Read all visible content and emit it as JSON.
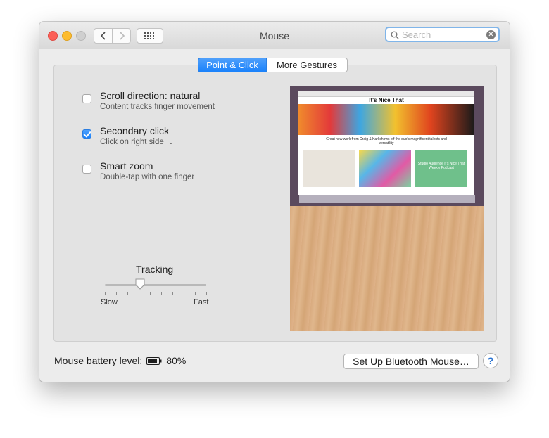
{
  "window": {
    "title": "Mouse"
  },
  "search": {
    "placeholder": "Search"
  },
  "tabs": [
    {
      "label": "Point & Click",
      "active": true
    },
    {
      "label": "More Gestures",
      "active": false
    }
  ],
  "options": [
    {
      "title": "Scroll direction: natural",
      "subtitle": "Content tracks finger movement",
      "checked": false
    },
    {
      "title": "Secondary click",
      "subtitle": "Click on right side",
      "checked": true,
      "has_dropdown": true
    },
    {
      "title": "Smart zoom",
      "subtitle": "Double-tap with one finger",
      "checked": false
    }
  ],
  "tracking": {
    "label": "Tracking",
    "min_label": "Slow",
    "max_label": "Fast",
    "value_fraction": 0.35,
    "tick_count": 10
  },
  "preview": {
    "site_title": "It's Nice That",
    "headline": "Great new work from Craig & Karl shows off the duo's magnificent talents and versatility",
    "card_text": "Studio Audience It's Nice That Weekly Podcast"
  },
  "footer": {
    "battery_label": "Mouse battery level:",
    "battery_value": "80%",
    "bluetooth_button": "Set Up Bluetooth Mouse…",
    "help": "?"
  },
  "colors": {
    "accent": "#1a82fb",
    "search_focus": "#80b5e9"
  },
  "icons": [
    "chevron-left-icon",
    "chevron-right-icon",
    "grid-icon",
    "search-icon",
    "clear-icon",
    "battery-icon",
    "chevron-down-icon"
  ]
}
